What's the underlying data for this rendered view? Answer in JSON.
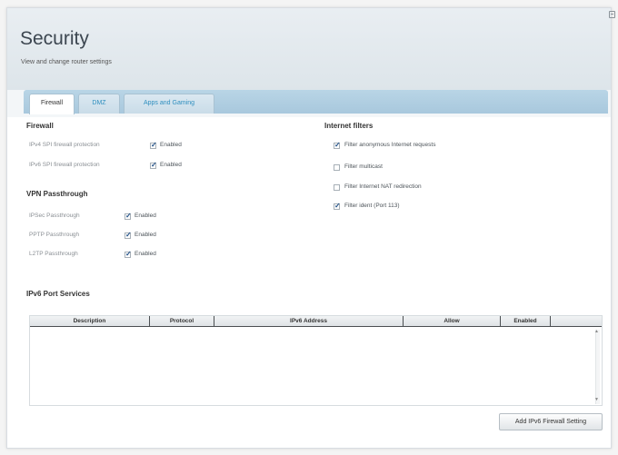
{
  "page": {
    "title": "Security",
    "subtitle": "View and change router settings"
  },
  "tabs": [
    {
      "label": "Firewall",
      "active": true
    },
    {
      "label": "DMZ",
      "active": false
    },
    {
      "label": "Apps and Gaming",
      "active": false
    }
  ],
  "firewall": {
    "title": "Firewall",
    "rows": [
      {
        "label": "IPv4 SPI firewall protection",
        "option": "Enabled",
        "checked": true
      },
      {
        "label": "IPv6 SPI firewall protection",
        "option": "Enabled",
        "checked": true
      }
    ]
  },
  "vpn": {
    "title": "VPN Passthrough",
    "rows": [
      {
        "label": "IPSec Passthrough",
        "option": "Enabled",
        "checked": true
      },
      {
        "label": "PPTP Passthrough",
        "option": "Enabled",
        "checked": true
      },
      {
        "label": "L2TP Passthrough",
        "option": "Enabled",
        "checked": true
      }
    ]
  },
  "internet_filters": {
    "title": "Internet filters",
    "items": [
      {
        "label": "Filter anonymous Internet requests",
        "checked": true
      },
      {
        "label": "Filter multicast",
        "checked": false
      },
      {
        "label": "Filter Internet NAT redirection",
        "checked": false
      },
      {
        "label": "Filter ident (Port 113)",
        "checked": true
      }
    ]
  },
  "ipv6_services": {
    "title": "IPv6 Port Services",
    "columns": [
      "Description",
      "Protocol",
      "IPv6 Address",
      "Allow",
      "Enabled",
      ""
    ],
    "add_button": "Add IPv6 Firewall Setting"
  },
  "icons": {
    "check": "checkmark-icon",
    "corner": "window-restore-icon",
    "scroll_up": "scroll-up-arrow-icon",
    "scroll_down": "scroll-down-arrow-icon"
  },
  "colors": {
    "tab_accent": "#2f8fbf",
    "tab_strip": "#b3d0e2",
    "header_bg": "#e5ebef"
  }
}
